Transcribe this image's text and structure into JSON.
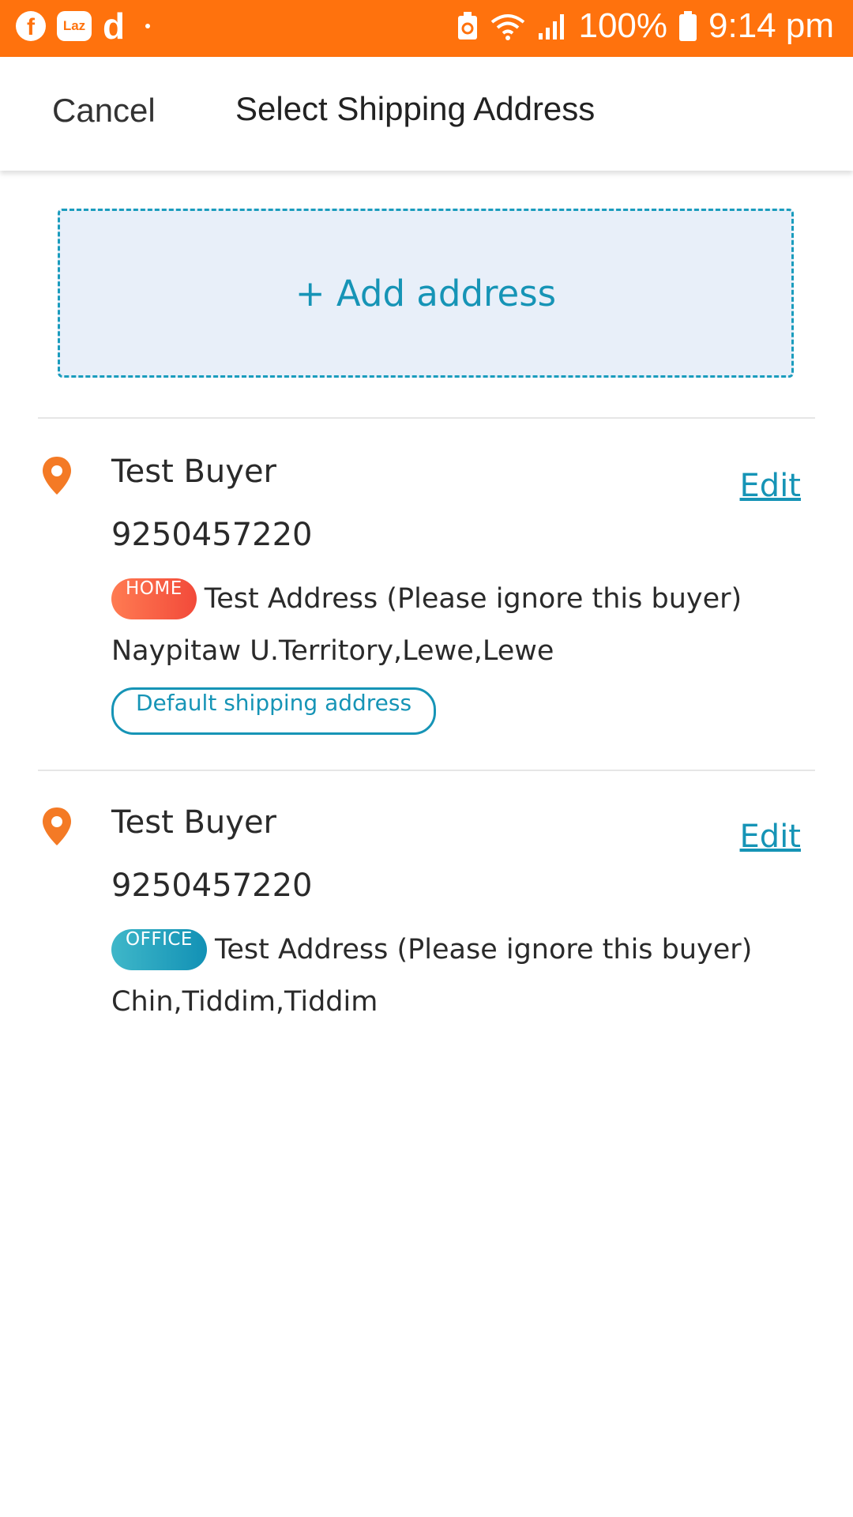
{
  "status_bar": {
    "fb_glyph": "f",
    "laz_glyph": "Laz",
    "d_glyph": "d",
    "battery_percent": "100%",
    "time": "9:14 pm",
    "icons": [
      "facebook-icon",
      "lazada-icon",
      "d-app-icon",
      "notification-dot-icon",
      "battery-saver-icon",
      "wifi-icon",
      "signal-icon",
      "battery-icon"
    ],
    "background_color": "#ff720d"
  },
  "header": {
    "cancel_label": "Cancel",
    "title": "Select Shipping Address"
  },
  "add_address": {
    "label": "+ Add address"
  },
  "addresses": [
    {
      "name": "Test Buyer",
      "phone": "9250457220",
      "tag": "HOME",
      "address_line1": "Test Address (Please ignore this buyer)",
      "address_line2": "Naypitaw U.Territory,Lewe,Lewe",
      "edit_label": "Edit",
      "default_label": "Default shipping address"
    },
    {
      "name": "Test Buyer",
      "phone": "9250457220",
      "tag": "OFFICE",
      "address_line1": "Test Address (Please ignore this buyer)",
      "address_line2": "Chin,Tiddim,Tiddim",
      "edit_label": "Edit"
    }
  ],
  "colors": {
    "accent": "#1694b6",
    "pin": "#f47a25",
    "home_tag": "#f24a3a",
    "office_tag": "#1291b5"
  }
}
